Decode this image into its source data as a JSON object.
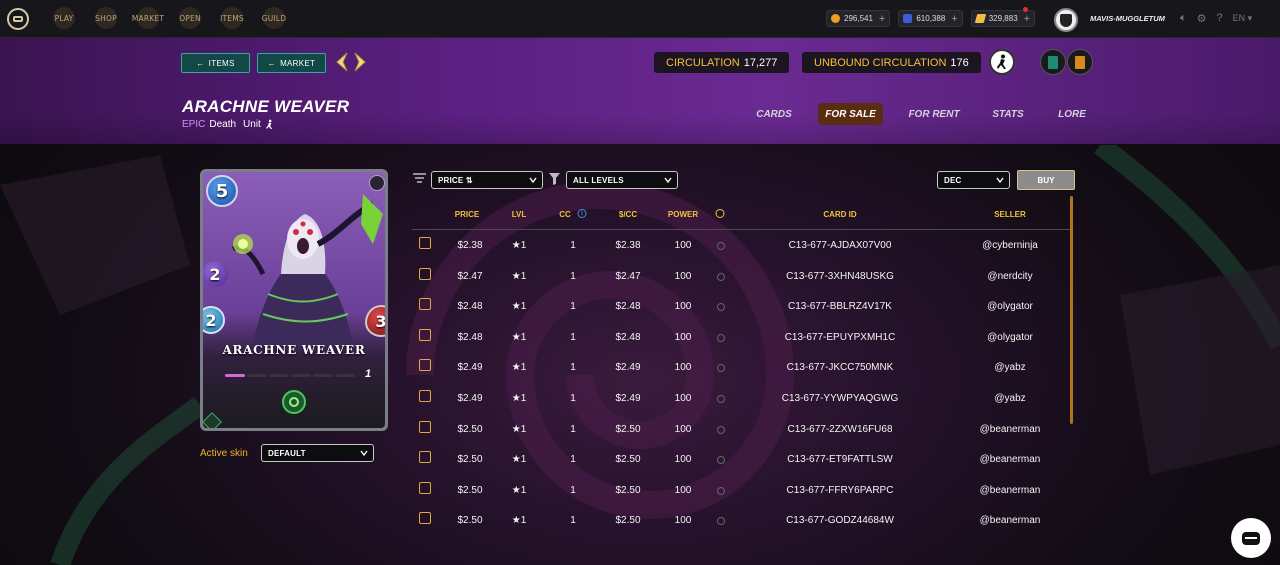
{
  "topbar": {
    "nav": [
      "PLAY",
      "SHOP",
      "MARKET",
      "OPEN",
      "ITEMS",
      "GUILD"
    ],
    "currencies": [
      {
        "icon": "dec-coin-icon",
        "value": "296,541",
        "color": "#f0a020"
      },
      {
        "icon": "sps-token-icon",
        "value": "610,388",
        "color": "#3c5cd8"
      },
      {
        "icon": "credits-icon",
        "value": "329,883",
        "color": "#f0c040"
      }
    ],
    "username": "MAVIS-MUGGLETUM",
    "language": "EN"
  },
  "header": {
    "items_button": "ITEMS",
    "market_button": "MARKET",
    "circulation_label": "CIRCULATION",
    "circulation_value": "17,277",
    "unbound_label": "UNBOUND CIRCULATION",
    "unbound_value": "176",
    "card_title": "ARACHNE WEAVER",
    "rarity": "EPIC",
    "element": "Death",
    "type": "Unit",
    "tabs": [
      "CARDS",
      "FOR SALE",
      "FOR RENT",
      "STATS",
      "LORE"
    ],
    "active_tab": "FOR SALE"
  },
  "card": {
    "name": "ARACHNE WEAVER",
    "mana": "5",
    "attack": "2",
    "speed": "2",
    "health": "3",
    "level": "1",
    "level_progress": 0.2
  },
  "skin": {
    "label": "Active skin",
    "value": "DEFAULT"
  },
  "filters": {
    "sort": "PRICE ⇅",
    "levels": "ALL LEVELS",
    "currency": "DEC",
    "buy_button": "BUY"
  },
  "table": {
    "headers": [
      "PRICE",
      "LVL",
      "CC",
      "$/CC",
      "POWER",
      "CARD ID",
      "SELLER"
    ],
    "rows": [
      {
        "price": "$2.38",
        "lvl": "★1",
        "cc": "1",
        "per_cc": "$2.38",
        "power": "100",
        "card_id": "C13-677-AJDAX07V00",
        "seller": "@cyberninja"
      },
      {
        "price": "$2.47",
        "lvl": "★1",
        "cc": "1",
        "per_cc": "$2.47",
        "power": "100",
        "card_id": "C13-677-3XHN48USKG",
        "seller": "@nerdcity"
      },
      {
        "price": "$2.48",
        "lvl": "★1",
        "cc": "1",
        "per_cc": "$2.48",
        "power": "100",
        "card_id": "C13-677-BBLRZ4V17K",
        "seller": "@olygator"
      },
      {
        "price": "$2.48",
        "lvl": "★1",
        "cc": "1",
        "per_cc": "$2.48",
        "power": "100",
        "card_id": "C13-677-EPUYPXMH1C",
        "seller": "@olygator"
      },
      {
        "price": "$2.49",
        "lvl": "★1",
        "cc": "1",
        "per_cc": "$2.49",
        "power": "100",
        "card_id": "C13-677-JKCC750MNK",
        "seller": "@yabz"
      },
      {
        "price": "$2.49",
        "lvl": "★1",
        "cc": "1",
        "per_cc": "$2.49",
        "power": "100",
        "card_id": "C13-677-YYWPYAQGWG",
        "seller": "@yabz"
      },
      {
        "price": "$2.50",
        "lvl": "★1",
        "cc": "1",
        "per_cc": "$2.50",
        "power": "100",
        "card_id": "C13-677-2ZXW16FU68",
        "seller": "@beanerman"
      },
      {
        "price": "$2.50",
        "lvl": "★1",
        "cc": "1",
        "per_cc": "$2.50",
        "power": "100",
        "card_id": "C13-677-ET9FATTLSW",
        "seller": "@beanerman"
      },
      {
        "price": "$2.50",
        "lvl": "★1",
        "cc": "1",
        "per_cc": "$2.50",
        "power": "100",
        "card_id": "C13-677-FFRY6PARPC",
        "seller": "@beanerman"
      },
      {
        "price": "$2.50",
        "lvl": "★1",
        "cc": "1",
        "per_cc": "$2.50",
        "power": "100",
        "card_id": "C13-677-GODZ44684W",
        "seller": "@beanerman"
      }
    ]
  }
}
